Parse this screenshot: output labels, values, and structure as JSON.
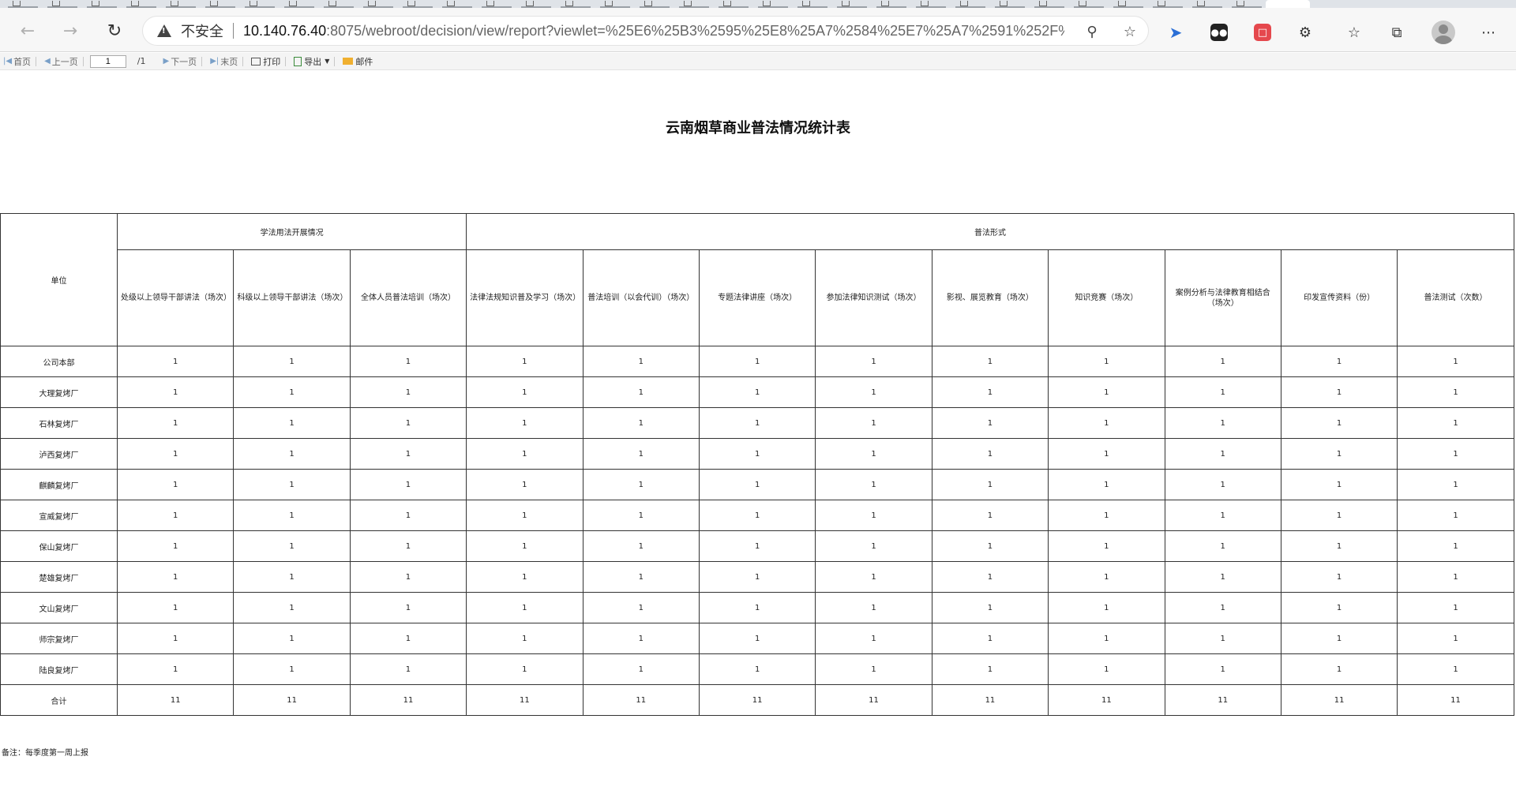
{
  "browser": {
    "insecure_label": "不安全",
    "url_host": "10.140.76.40",
    "url_rest": ":8075/webroot/decision/view/report?viewlet=%25E6%25B3%2595%25E8%25A7%2584%25E7%25A7%2591%252F%25E4...",
    "icons": [
      "back-icon",
      "forward-icon",
      "reload-icon",
      "warning-icon",
      "zoom-icon",
      "favorite-add-icon",
      "extension-blue-icon",
      "extension-dark-icon",
      "extension-red-icon",
      "extensions-icon",
      "favorites-icon",
      "collections-icon",
      "profile-avatar",
      "more-icon"
    ]
  },
  "report_toolbar": {
    "first": "首页",
    "prev": "上一页",
    "page_value": "1",
    "total": "/1",
    "next": "下一页",
    "last": "末页",
    "print": "打印",
    "export": "导出",
    "mail": "邮件"
  },
  "report": {
    "title": "云南烟草商业普法情况统计表",
    "unit_header": "单位",
    "group1": "学法用法开展情况",
    "group2": "普法形式",
    "columns": [
      "处级以上领导干部讲法（场次）",
      "科级以上领导干部讲法（场次）",
      "全体人员普法培训（场次）",
      "法律法规知识普及学习（场次）",
      "普法培训（以会代训）（场次）",
      "专题法律讲座（场次）",
      "参加法律知识测试（场次）",
      "影视、展览教育（场次）",
      "知识竞赛（场次）",
      "案例分析与法律教育相结合（场次）",
      "印发宣传资料（份）",
      "普法测试（次数）"
    ],
    "rows": [
      {
        "unit": "公司本部",
        "values": [
          "1",
          "1",
          "1",
          "1",
          "1",
          "1",
          "1",
          "1",
          "1",
          "1",
          "1",
          "1"
        ]
      },
      {
        "unit": "大理复烤厂",
        "values": [
          "1",
          "1",
          "1",
          "1",
          "1",
          "1",
          "1",
          "1",
          "1",
          "1",
          "1",
          "1"
        ]
      },
      {
        "unit": "石林复烤厂",
        "values": [
          "1",
          "1",
          "1",
          "1",
          "1",
          "1",
          "1",
          "1",
          "1",
          "1",
          "1",
          "1"
        ]
      },
      {
        "unit": "泸西复烤厂",
        "values": [
          "1",
          "1",
          "1",
          "1",
          "1",
          "1",
          "1",
          "1",
          "1",
          "1",
          "1",
          "1"
        ]
      },
      {
        "unit": "麒麟复烤厂",
        "values": [
          "1",
          "1",
          "1",
          "1",
          "1",
          "1",
          "1",
          "1",
          "1",
          "1",
          "1",
          "1"
        ]
      },
      {
        "unit": "宣威复烤厂",
        "values": [
          "1",
          "1",
          "1",
          "1",
          "1",
          "1",
          "1",
          "1",
          "1",
          "1",
          "1",
          "1"
        ]
      },
      {
        "unit": "保山复烤厂",
        "values": [
          "1",
          "1",
          "1",
          "1",
          "1",
          "1",
          "1",
          "1",
          "1",
          "1",
          "1",
          "1"
        ]
      },
      {
        "unit": "楚雄复烤厂",
        "values": [
          "1",
          "1",
          "1",
          "1",
          "1",
          "1",
          "1",
          "1",
          "1",
          "1",
          "1",
          "1"
        ]
      },
      {
        "unit": "文山复烤厂",
        "values": [
          "1",
          "1",
          "1",
          "1",
          "1",
          "1",
          "1",
          "1",
          "1",
          "1",
          "1",
          "1"
        ]
      },
      {
        "unit": "师宗复烤厂",
        "values": [
          "1",
          "1",
          "1",
          "1",
          "1",
          "1",
          "1",
          "1",
          "1",
          "1",
          "1",
          "1"
        ]
      },
      {
        "unit": "陆良复烤厂",
        "values": [
          "1",
          "1",
          "1",
          "1",
          "1",
          "1",
          "1",
          "1",
          "1",
          "1",
          "1",
          "1"
        ]
      },
      {
        "unit": "合计",
        "values": [
          "11",
          "11",
          "11",
          "11",
          "11",
          "11",
          "11",
          "11",
          "11",
          "11",
          "11",
          "11"
        ]
      }
    ],
    "note": "备注：每季度第一周上报"
  }
}
